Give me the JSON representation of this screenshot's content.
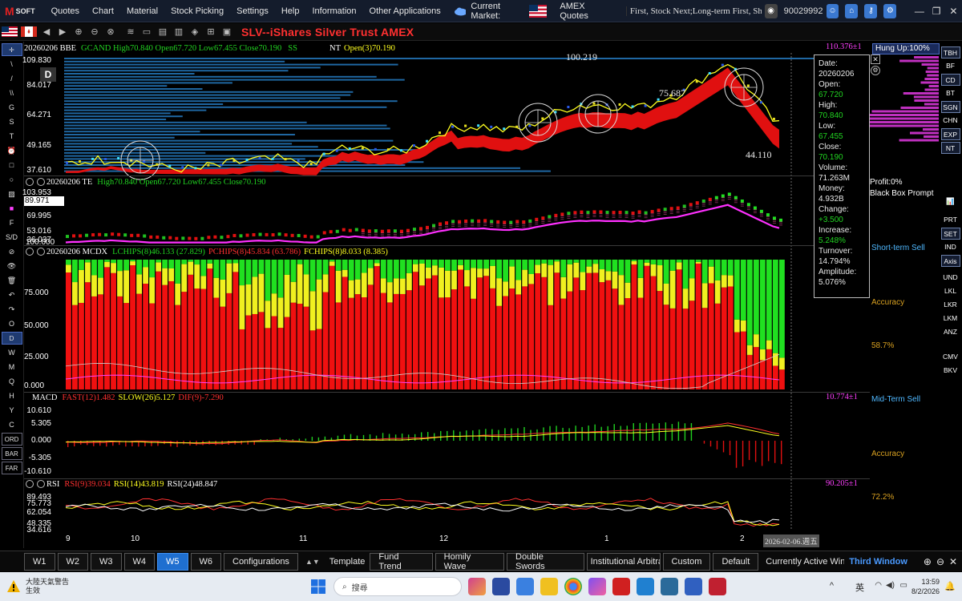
{
  "menubar": {
    "logo_main": "M",
    "logo_sub": "SOFT",
    "items": [
      "Quotes",
      "Chart",
      "Material",
      "Stock Picking",
      "Settings",
      "Help",
      "Information",
      "Other Applications"
    ],
    "current_market_label": "Current Market:",
    "market_name": "AMEX Quotes",
    "ticker_text": "First, Stock Next;Long-term First, Short-te",
    "account": "90029992"
  },
  "toolbar": {
    "title": "SLV--iShares Silver Trust  AMEX"
  },
  "left_tools": [
    "✛",
    "\\",
    "/",
    "\\\\",
    "G",
    "S",
    "T",
    "⏰",
    "□",
    "○",
    "▨",
    "■",
    "F",
    "S/D",
    "⊘",
    "👁",
    "🗑",
    "↶",
    "↷",
    "O",
    "D",
    "W",
    "M",
    "Q",
    "H",
    "Y",
    "C",
    "ORD",
    "BAR",
    "FAR"
  ],
  "main_panel": {
    "header_prefix": "20260206 BBE",
    "header_values": "GCAND High70.840 Open67.720 Low67.455 Close70.190",
    "header_ss": "SS",
    "header_nt": "NT",
    "header_nt_value": "Open(3)70.190",
    "right_value": "110.376±1",
    "badge": "D",
    "y_ticks": [
      "109.830",
      "84.017",
      "64.271",
      "49.165",
      "37.610"
    ],
    "annotation_high": "100.219",
    "annotation_mid": "75.687",
    "annotation_low": "44.110"
  },
  "te_panel": {
    "header_prefix": "20260206 TE",
    "header_values": "High70.840 Open67.720 Low67.455 Close70.190",
    "y_ticks": [
      "103.953",
      "89.971",
      "69.995",
      "53.016",
      "36.037"
    ]
  },
  "mcdx_panel": {
    "header_prefix": "20260206 MCDX",
    "lchips": "LCHIPS(8)46.133 (27.829)",
    "pchips": "PCHIPS(8)45.834 (63.786)",
    "fchips": "FCHIPS(8)8.033 (8.385)",
    "y_ticks": [
      "100.000",
      "75.000",
      "50.000",
      "25.000",
      "0.000"
    ]
  },
  "macd_panel": {
    "header_prefix": "MACD",
    "fast": "FAST(12)1.482",
    "slow": "SLOW(26)5.127",
    "dif": "DIF(9)-7.290",
    "right_value": "10.774±1",
    "y_ticks": [
      "10.610",
      "5.305",
      "0.000",
      "-5.305",
      "-10.610"
    ]
  },
  "rsi_panel": {
    "header_prefix": "RSI",
    "rsi9": "RSI(9)39.034",
    "rsi14": "RSI(14)43.819",
    "rsi24": "RSI(24)48.847",
    "right_value": "90.205±1",
    "y_ticks": [
      "89.493",
      "75.773",
      "62.054",
      "48.335",
      "34.616"
    ]
  },
  "x_axis": {
    "labels": [
      "9",
      "10",
      "11",
      "12",
      "1",
      "2"
    ],
    "cursor_date": "2026-02-06.週五"
  },
  "infobox": {
    "date_label": "Date:",
    "date": "20260206",
    "open_label": "Open:",
    "open": "67.720",
    "high_label": "High:",
    "high": "70.840",
    "low_label": "Low:",
    "low": "67.455",
    "close_label": "Close:",
    "close": "70.190",
    "volume_label": "Volume:",
    "volume": "71.263M",
    "money_label": "Money:",
    "money": "4.932B",
    "change_label": "Change:",
    "change": "+3.500",
    "increase_label": "Increase:",
    "increase": "5.248%",
    "turnover_label": "Turnover:",
    "turnover": "14.794%",
    "amplitude_label": "Amplitude:",
    "amplitude": "5.076%"
  },
  "right_panel": {
    "hung_up": "Hung Up:100%",
    "profit": "Profit:0%",
    "black_box": "Black Box Prompt",
    "short_term": "Short-term Sell",
    "accuracy1_label": "Accuracy",
    "accuracy1": "58.7%",
    "mid_term": "Mid-Term Sell",
    "accuracy2_label": "Accuracy",
    "accuracy2": "72.2%"
  },
  "right_buttons": [
    "TBH",
    "BF",
    "CD",
    "BT",
    "SGN",
    "CHN",
    "EXP",
    "NT",
    "📊",
    "PRT",
    "SET",
    "IND",
    "Axis",
    "UND",
    "LKL",
    "LKR",
    "LKM",
    "ANZ",
    "CMV",
    "BKV"
  ],
  "bottom_tabs": {
    "week_tabs": [
      "W1",
      "W2",
      "W3",
      "W4",
      "W5",
      "W6"
    ],
    "active": "W5",
    "configurations": "Configurations",
    "template": "Template",
    "tabs": [
      "Fund Trend",
      "Homily Wave",
      "Double Swords",
      "Institutional Arbitra",
      "Custom",
      "Default"
    ],
    "currently_active": "Currently Active Winc",
    "third_window": "Third Window"
  },
  "taskbar": {
    "weather_line1": "大陸天氣警告",
    "weather_line2": "生效",
    "search": "搜尋",
    "lang": "英",
    "time": "13:59",
    "date": "8/2/2026"
  },
  "colors": {
    "accent_red": "#ff3030",
    "up_green": "#21d321",
    "magenta": "#ff40ff",
    "yellow": "#ffff20",
    "accuracy_orange": "#d8a020",
    "cyan": "#4fb8ff"
  }
}
